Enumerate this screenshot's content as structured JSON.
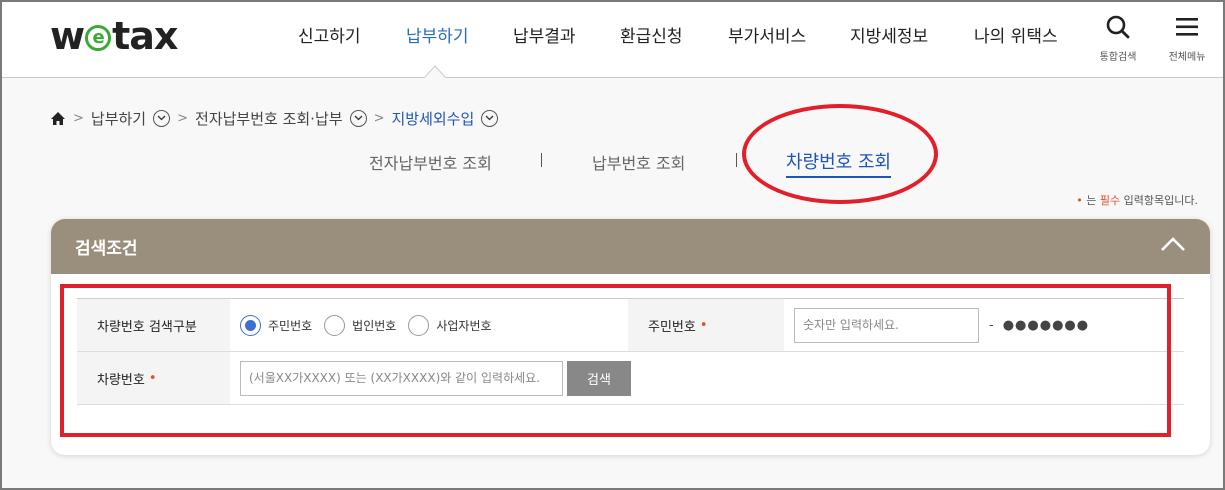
{
  "header": {
    "logo_pre": "w",
    "logo_e": "e",
    "logo_post": "tax",
    "nav": [
      "신고하기",
      "납부하기",
      "납부결과",
      "환급신청",
      "부가서비스",
      "지방세정보",
      "나의 위택스"
    ],
    "active_nav_index": 1,
    "search_label": "통합검색",
    "menu_label": "전체메뉴",
    "accent_color": "#2a6ac8"
  },
  "breadcrumb": {
    "home_icon": "home-icon",
    "items": [
      "납부하기",
      "전자납부번호 조회·납부",
      "지방세외수입"
    ]
  },
  "tabs": {
    "items": [
      "전자납부번호 조회",
      "납부번호 조회",
      "차량번호 조회"
    ],
    "active_index": 2,
    "separator": "|"
  },
  "required_note": {
    "dot": "•",
    "pre": " 는 ",
    "must": "필수",
    "post": " 입력항목입니다."
  },
  "panel": {
    "title": "검색조건",
    "header_color": "#9a8e7d",
    "rows": {
      "search_type_label": "차량번호 검색구분",
      "radios": [
        "주민번호",
        "법인번호",
        "사업자번호"
      ],
      "selected_radio": 0,
      "resident_label": "주민번호",
      "resident_star": "•",
      "resident_placeholder": "숫자만 입력하세요.",
      "resident_dash": "-",
      "resident_masked": "●●●●●●●",
      "vehicle_label": "차량번호",
      "vehicle_star": "•",
      "vehicle_placeholder": "(서울XX가XXXX) 또는 (XX가XXXX)와 같이 입력하세요.",
      "search_button": "검색"
    }
  },
  "highlight_color": "#e0202a"
}
